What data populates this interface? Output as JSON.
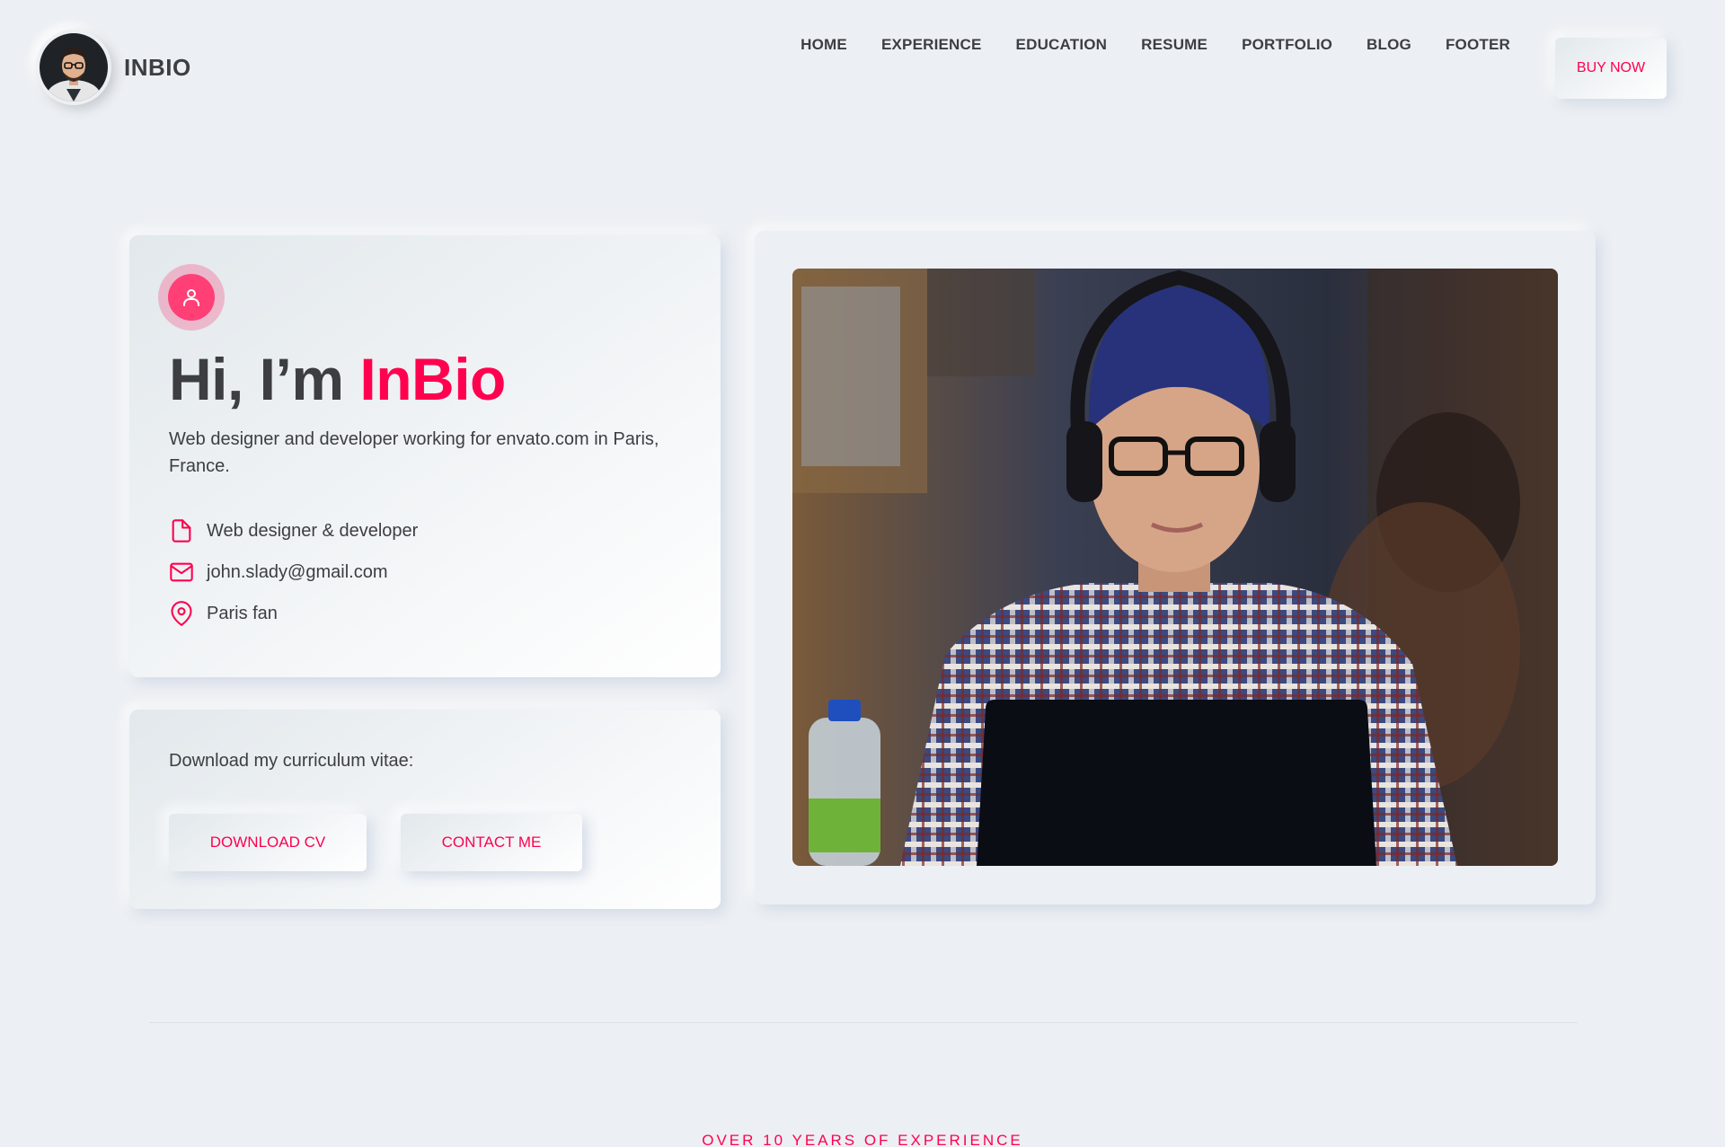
{
  "header": {
    "brand": "INBIO",
    "nav": [
      "HOME",
      "EXPERIENCE",
      "EDUCATION",
      "RESUME",
      "PORTFOLIO",
      "BLOG",
      "FOOTER"
    ],
    "cta": "BUY NOW"
  },
  "intro": {
    "greeting": "Hi, I’m ",
    "name": "InBio",
    "description": "Web designer and developer working for envato.com in Paris, France.",
    "info": [
      {
        "icon": "file-icon",
        "text": "Web designer & developer"
      },
      {
        "icon": "mail-icon",
        "text": "john.slady@gmail.com"
      },
      {
        "icon": "map-pin-icon",
        "text": "Paris fan"
      }
    ]
  },
  "cv": {
    "label": "Download my curriculum vitae:",
    "download": "DOWNLOAD CV",
    "contact": "CONTACT ME"
  },
  "section": {
    "subtitle": "OVER 10 YEARS OF EXPERIENCE"
  },
  "colors": {
    "accent": "#ff014f",
    "background": "#eceff3",
    "text": "#3c3e41"
  }
}
